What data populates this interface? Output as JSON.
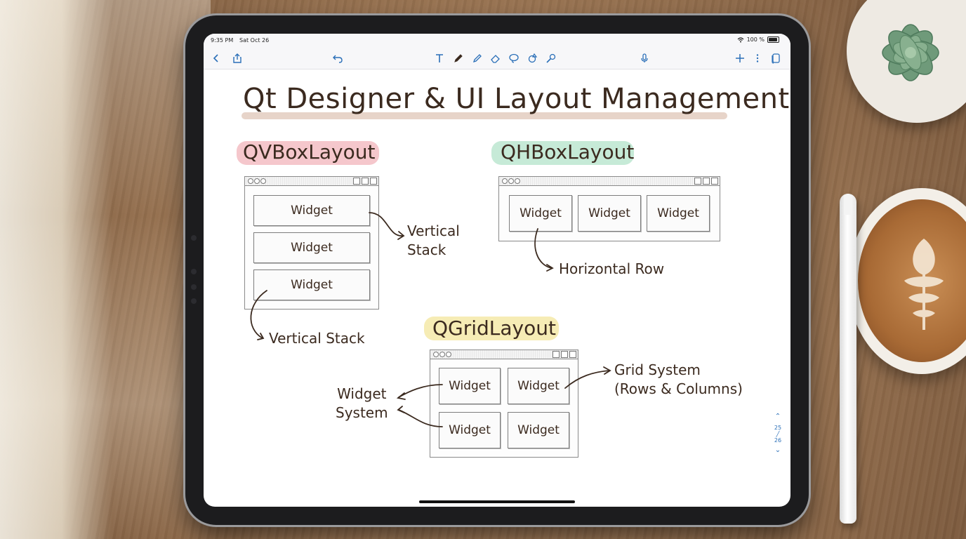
{
  "status_bar": {
    "time": "9:35 PM",
    "date": "Sat Oct 26",
    "battery": "100 %"
  },
  "toolbar": {
    "left_icons": [
      "back-icon",
      "share-icon",
      "undo-icon"
    ],
    "tool_icons": [
      "text-tool-icon",
      "pen-icon",
      "highlighter-icon",
      "eraser-icon",
      "lasso-icon",
      "shapes-icon",
      "pointer-icon"
    ],
    "right_icons": [
      "microphone-icon",
      "plus-icon",
      "more-icon",
      "pages-icon"
    ]
  },
  "note": {
    "title": "Qt Designer & UI Layout Management",
    "sections": {
      "vbox": {
        "label": "QVBoxLayout",
        "highlight_color": "#f5c7cc",
        "widgets": [
          "Widget",
          "Widget",
          "Widget"
        ],
        "annotation_right": [
          "Vertical",
          "Stack"
        ],
        "annotation_bottom": "Vertical Stack"
      },
      "hbox": {
        "label": "QHBoxLayout",
        "highlight_color": "#c6ead7",
        "widgets": [
          "Widget",
          "Widget",
          "Widget"
        ],
        "annotation": "Horizontal Row"
      },
      "grid": {
        "label": "QGridLayout",
        "highlight_color": "#f6ecb5",
        "widgets": [
          "Widget",
          "Widget",
          "Widget",
          "Widget"
        ],
        "annotation_left": [
          "Widget",
          "System"
        ],
        "annotation_right": [
          "Grid System",
          "(Rows & Columns)"
        ]
      }
    }
  },
  "pager": {
    "current": "25",
    "total": "26"
  },
  "colors": {
    "ink": "#3b2a1f",
    "accent": "#2a6fb8"
  }
}
